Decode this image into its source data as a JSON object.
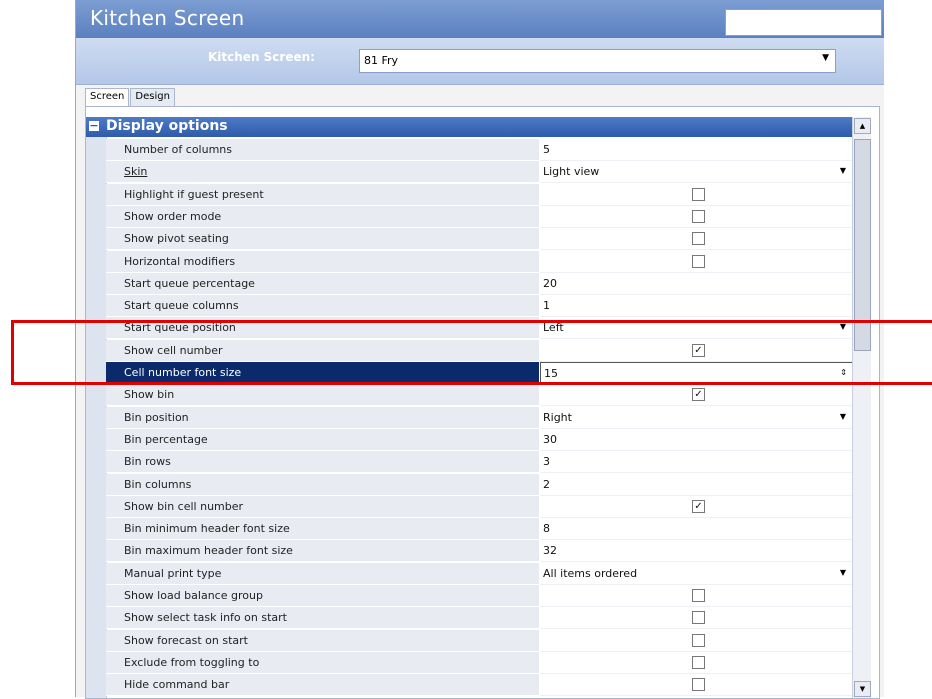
{
  "window": {
    "title": "Kitchen Screen"
  },
  "selector": {
    "label": "Kitchen Screen:",
    "value": "81 Fry"
  },
  "tabs": [
    "Screen",
    "Design"
  ],
  "group": {
    "title": "Display options"
  },
  "rows": [
    {
      "label": "Number of columns",
      "type": "text",
      "value": "5"
    },
    {
      "label": "Skin",
      "type": "dropdown",
      "value": "Light view",
      "underline": true
    },
    {
      "label": "Highlight if guest present",
      "type": "checkbox",
      "checked": false
    },
    {
      "label": "Show order mode",
      "type": "checkbox",
      "checked": false
    },
    {
      "label": "Show pivot seating",
      "type": "checkbox",
      "checked": false
    },
    {
      "label": "Horizontal modifiers",
      "type": "checkbox",
      "checked": false
    },
    {
      "label": "Start queue percentage",
      "type": "text",
      "value": "20"
    },
    {
      "label": "Start queue columns",
      "type": "text",
      "value": "1"
    },
    {
      "label": "Start queue position",
      "type": "dropdown",
      "value": "Left"
    },
    {
      "label": "Show cell number",
      "type": "checkbox",
      "checked": true
    },
    {
      "label": "Cell number font size",
      "type": "spinner",
      "value": "15",
      "selected": true
    },
    {
      "label": "Show bin",
      "type": "checkbox",
      "checked": true
    },
    {
      "label": "Bin position",
      "type": "dropdown",
      "value": "Right"
    },
    {
      "label": "Bin percentage",
      "type": "text",
      "value": "30"
    },
    {
      "label": "Bin rows",
      "type": "text",
      "value": "3"
    },
    {
      "label": "Bin columns",
      "type": "text",
      "value": "2"
    },
    {
      "label": "Show bin cell number",
      "type": "checkbox",
      "checked": true
    },
    {
      "label": "Bin minimum header font size",
      "type": "text",
      "value": "8"
    },
    {
      "label": "Bin maximum header font size",
      "type": "text",
      "value": "32"
    },
    {
      "label": "Manual print type",
      "type": "dropdown",
      "value": "All items ordered"
    },
    {
      "label": "Show load balance group",
      "type": "checkbox",
      "checked": false
    },
    {
      "label": "Show select task info on start",
      "type": "checkbox",
      "checked": false
    },
    {
      "label": "Show forecast on start",
      "type": "checkbox",
      "checked": false
    },
    {
      "label": "Exclude from toggling to",
      "type": "checkbox",
      "checked": false
    },
    {
      "label": "Hide command bar",
      "type": "checkbox",
      "checked": false
    }
  ],
  "colors": {
    "callout": "#e00000",
    "selected_row": "#0a2a6b",
    "header": "#2e5bab"
  }
}
